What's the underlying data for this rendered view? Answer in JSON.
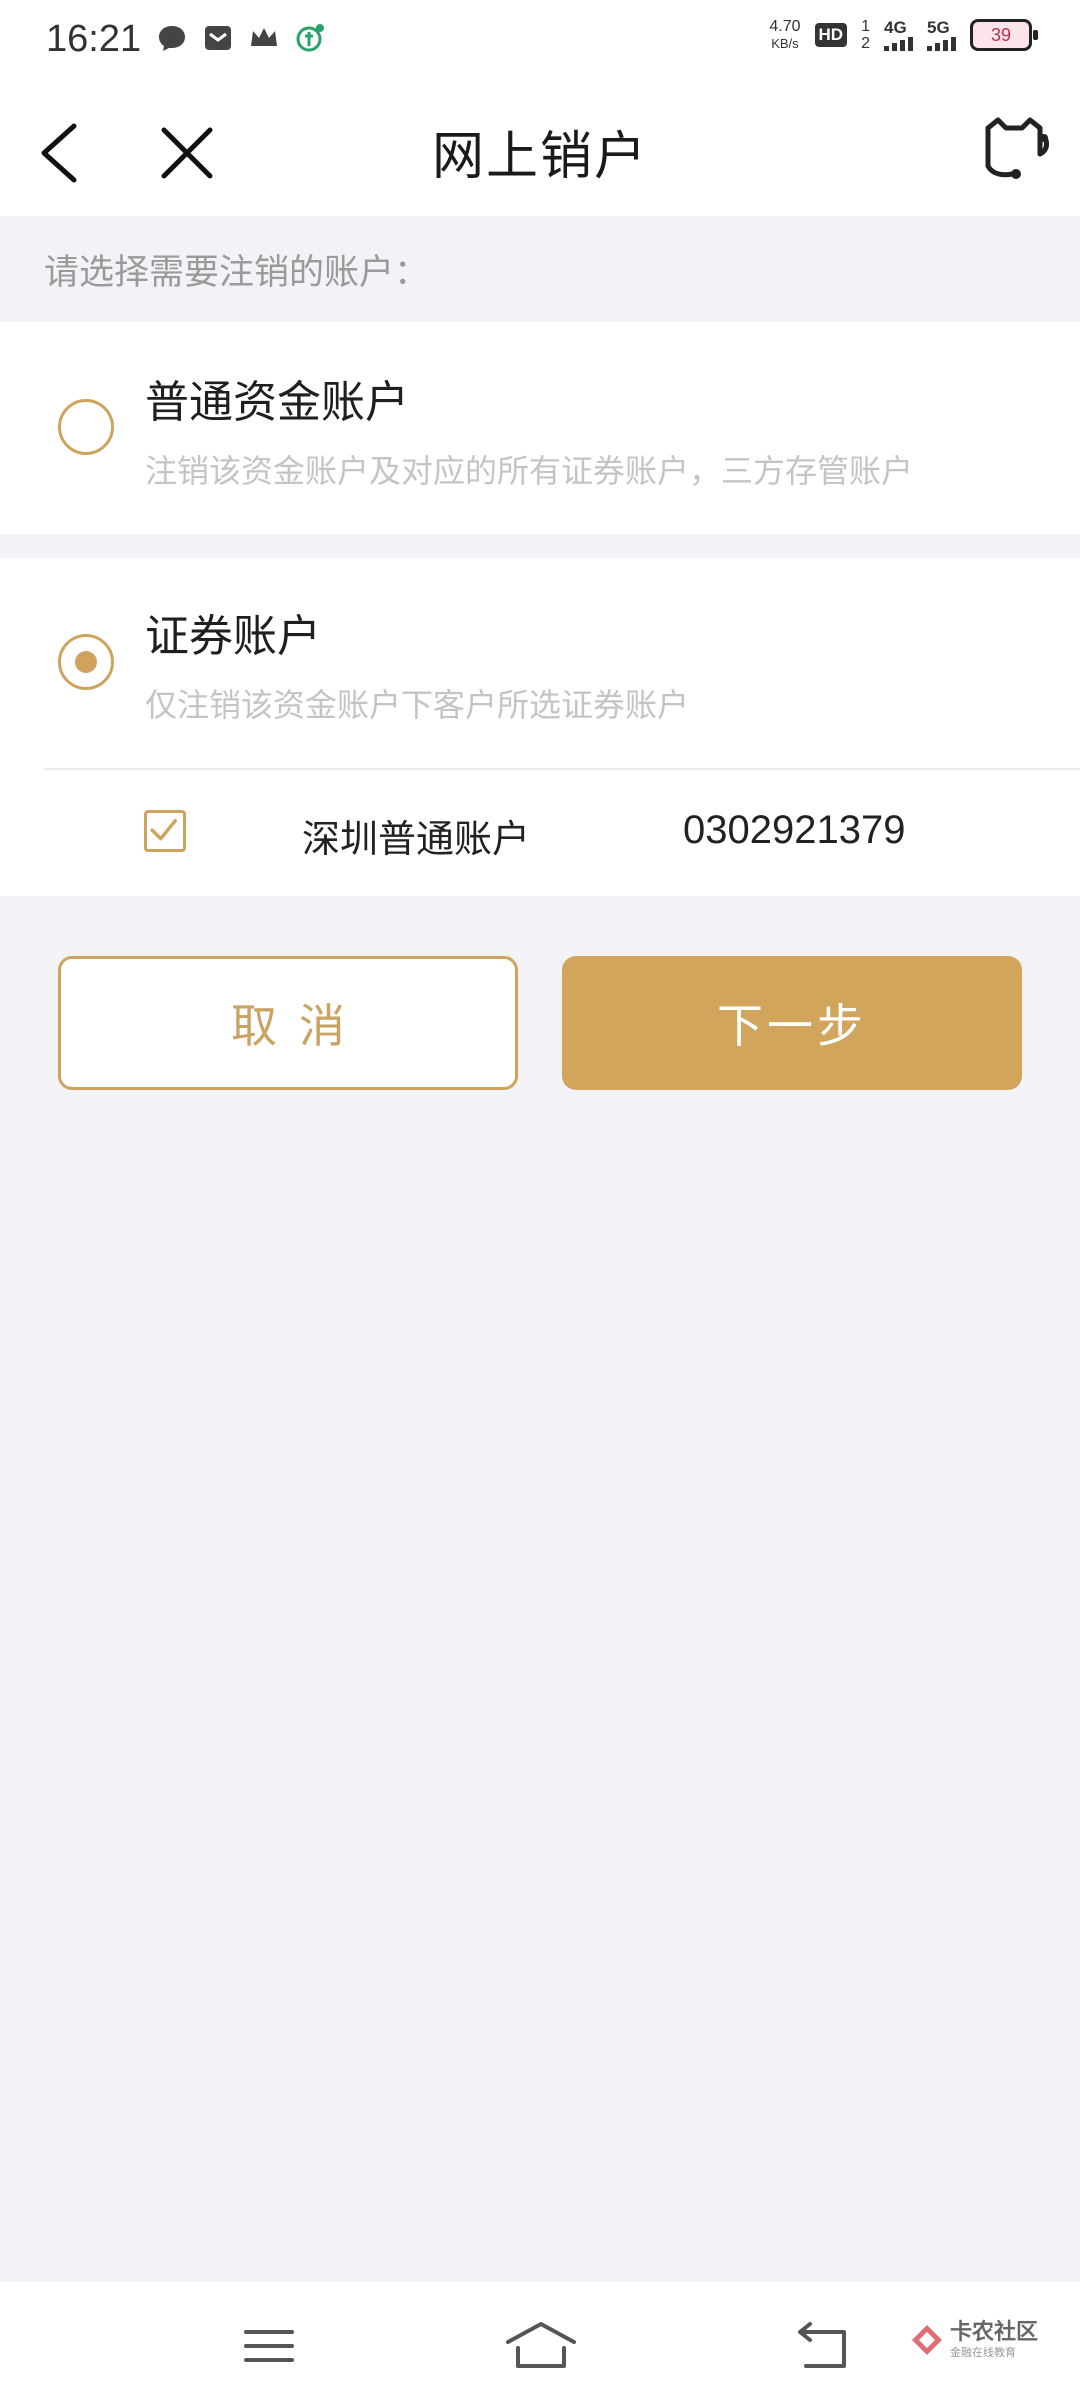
{
  "status_bar": {
    "time": "16:21",
    "net_speed_value": "4.70",
    "net_speed_unit": "KB/s",
    "hd_label": "HD",
    "sim_top": "1",
    "sim_bottom": "2",
    "signal1_label": "4G",
    "signal2_label": "5G",
    "battery_level": "39",
    "icons_left": [
      "message-bubble-icon",
      "mail-icon",
      "crown-icon",
      "app-notification-icon"
    ]
  },
  "header": {
    "title": "网上销户",
    "back_icon": "chevron-left-icon",
    "close_icon": "close-icon",
    "service_icon": "customer-service-icon"
  },
  "prompt": "请选择需要注销的账户：",
  "options": [
    {
      "title": "普通资金账户",
      "description": "注销该资金账户及对应的所有证券账户，三方存管账户",
      "selected": false
    },
    {
      "title": "证券账户",
      "description": "仅注销该资金账户下客户所选证券账户",
      "selected": true,
      "sub_accounts": [
        {
          "name": "深圳普通账户",
          "number": "0302921379",
          "checked": true
        }
      ]
    }
  ],
  "buttons": {
    "cancel": "取消",
    "next": "下一步"
  },
  "colors": {
    "accent": "#d2a55c",
    "background": "#f2f2f7",
    "muted_text": "#c4c4c4"
  },
  "nav_bar": {
    "icons": [
      "menu-icon",
      "home-icon",
      "back-arrow-icon"
    ],
    "watermark_main": "卡农社区",
    "watermark_sub": "金融在线教育"
  }
}
